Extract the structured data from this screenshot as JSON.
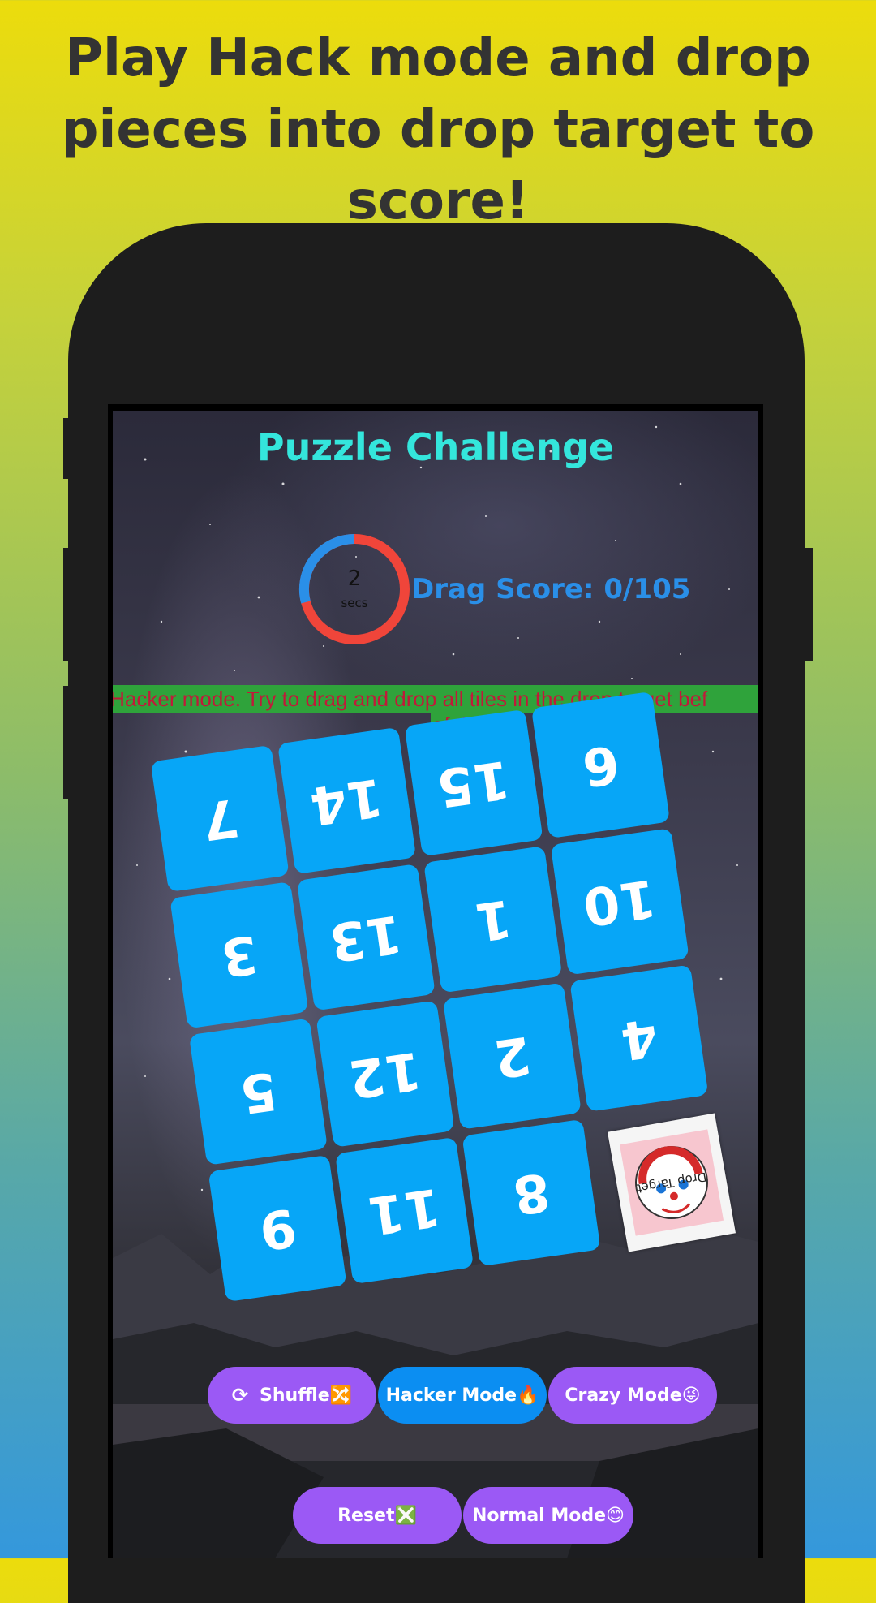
{
  "promo": {
    "line1": "Play Hack mode and drop",
    "line2": "pieces into drop target to score!"
  },
  "app": {
    "title": "Puzzle Challenge",
    "timer": {
      "value": "2",
      "unit": "secs",
      "progress": 0.75
    },
    "score_text": "Drag Score: 0/105",
    "banner_text": "cked Hacker mode. Try to drag and drop all tiles in the drop target bef",
    "banner_text2": "of time",
    "tiles": [
      "7",
      "14",
      "15",
      "6",
      "3",
      "13",
      "1",
      "10",
      "5",
      "12",
      "2",
      "4",
      "9",
      "11",
      "8"
    ],
    "drop_target_label": "Drop Target",
    "buttons": {
      "shuffle": "Shuffle🔀",
      "shuffle_icon": "refresh-icon",
      "hacker": "Hacker Mode🔥",
      "crazy": "Crazy Mode😜",
      "reset": "Reset❎",
      "normal": "Normal Mode😊"
    }
  },
  "colors": {
    "title": "#34e6dc",
    "score": "#2a8fe8",
    "tile": "#07a6f7",
    "button_purple": "#9b59f5",
    "button_blue": "#0b8ef2",
    "banner_bg": "#2fa33b",
    "banner_text": "#c01a3a"
  }
}
